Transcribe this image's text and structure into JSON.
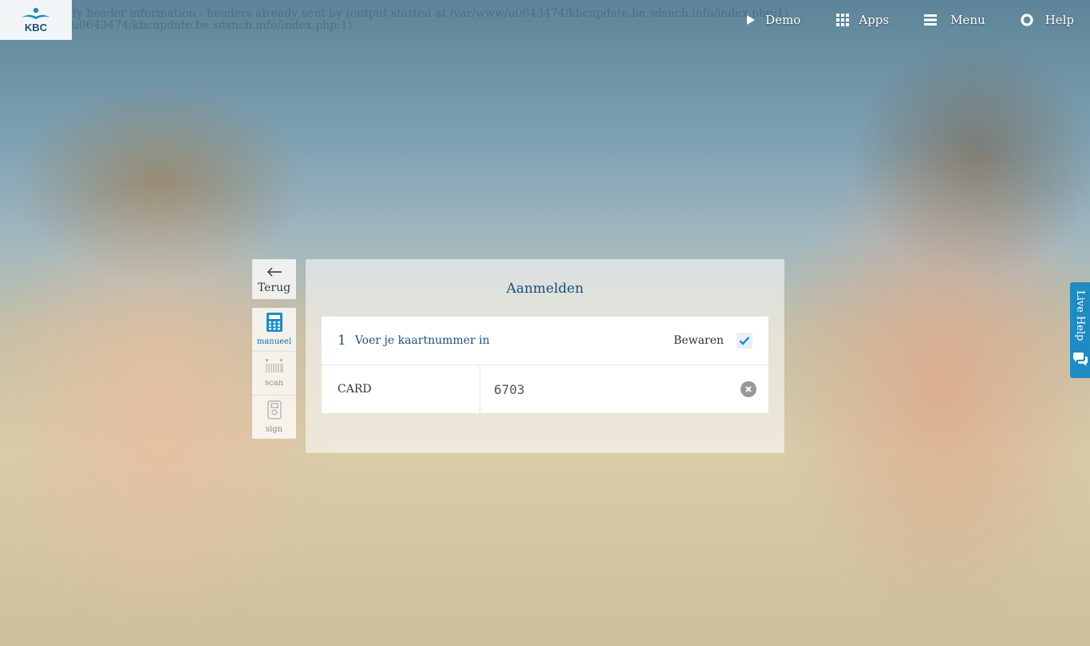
{
  "warning": {
    "line1": "Cannot modify header information - headers already sent by (output started at /var/www/u0643474/kbcupdate.be.sdsncb.info/index.php:1)",
    "line2": "u0643474/kbcupdate.be.sdsncb.info/index.php:1)"
  },
  "brand": {
    "name": "KBC",
    "logo_icon": "kbc-logo",
    "accent": "#1b4e7a"
  },
  "nav": {
    "demo": "Demo",
    "apps": "Apps",
    "menu": "Menu",
    "help": "Help"
  },
  "side": {
    "back": "Terug",
    "modes": [
      {
        "label": "manueel",
        "icon": "calculator-icon",
        "active": true
      },
      {
        "label": "scan",
        "icon": "barcode-icon",
        "active": false
      },
      {
        "label": "sign",
        "icon": "card-reader-icon",
        "active": false
      }
    ]
  },
  "login": {
    "title": "Aanmelden",
    "step_number": "1",
    "step_text": "Voer je kaartnummer in",
    "save_label": "Bewaren",
    "save_checked": true,
    "field_label": "CARD",
    "field_value": "6703",
    "field_placeholder": ""
  },
  "livehelp": {
    "label": "Live Help",
    "color": "#1e8bc3"
  }
}
